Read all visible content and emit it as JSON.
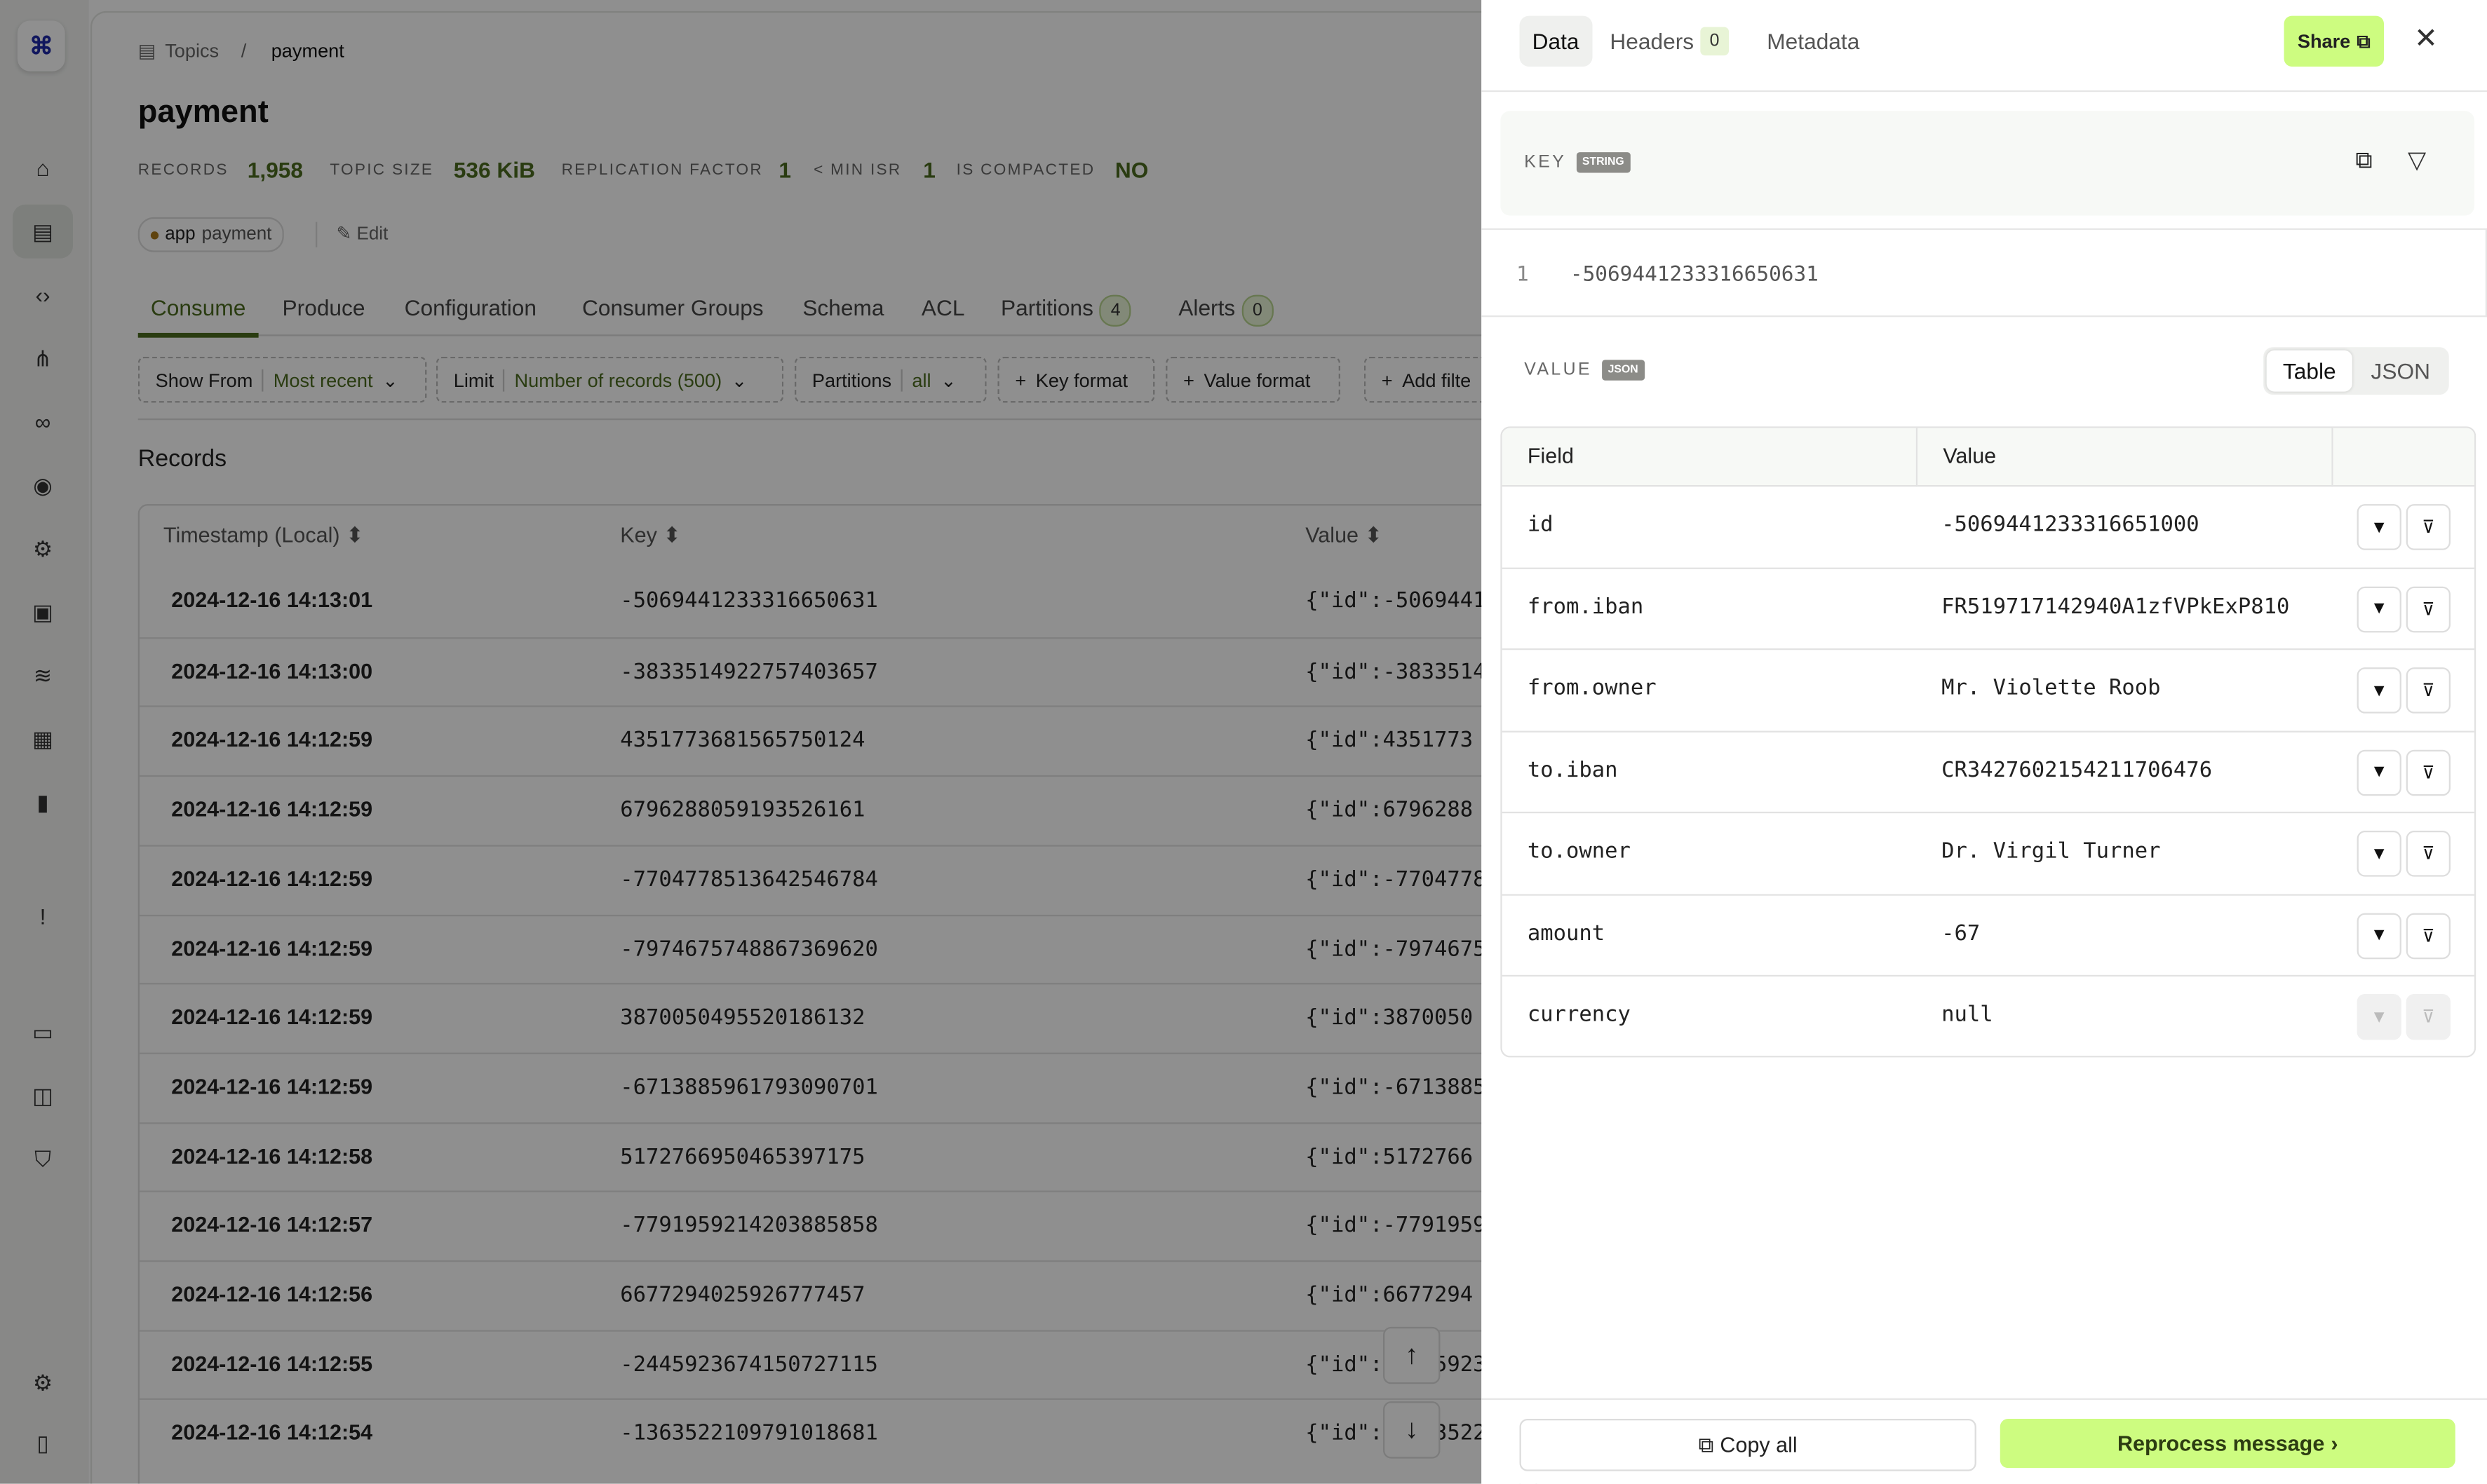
{
  "sidebar": {
    "logo": "kafka-logo",
    "items": [
      {
        "icon": "home-icon"
      },
      {
        "icon": "topics-icon",
        "active": true
      },
      {
        "icon": "code-icon"
      },
      {
        "icon": "hierarchy-icon"
      },
      {
        "icon": "link-icon"
      },
      {
        "icon": "brain-icon"
      },
      {
        "icon": "chip-icon"
      },
      {
        "icon": "file-lock-icon"
      },
      {
        "icon": "database-icon"
      },
      {
        "icon": "table-icon"
      },
      {
        "icon": "bar-chart-icon"
      },
      {
        "icon": "alert-icon"
      },
      {
        "icon": "window-icon"
      },
      {
        "icon": "layout-icon"
      },
      {
        "icon": "shield-icon"
      },
      {
        "icon": "settings-icon"
      },
      {
        "icon": "sidebar-toggle-icon"
      }
    ]
  },
  "breadcrumb": {
    "parent": "Topics",
    "separator": "/",
    "current": "payment"
  },
  "topic": {
    "title": "payment",
    "stats": [
      {
        "label": "RECORDS",
        "value": "1,958"
      },
      {
        "label": "TOPIC SIZE",
        "value": "536 KiB"
      },
      {
        "label": "REPLICATION FACTOR",
        "value": "1"
      },
      {
        "label": "< MIN ISR",
        "value": "1"
      },
      {
        "label": "IS COMPACTED",
        "value": "NO"
      }
    ],
    "tag": {
      "key": "app",
      "value": "payment"
    },
    "edit_label": "Edit"
  },
  "tabs": [
    {
      "label": "Consume",
      "active": true
    },
    {
      "label": "Produce"
    },
    {
      "label": "Configuration"
    },
    {
      "label": "Consumer Groups"
    },
    {
      "label": "Schema"
    },
    {
      "label": "ACL"
    },
    {
      "label": "Partitions",
      "badge": "4"
    },
    {
      "label": "Alerts",
      "badge": "0"
    }
  ],
  "filters": [
    {
      "label": "Show From",
      "value": "Most recent"
    },
    {
      "label": "Limit",
      "value": "Number of records (500)"
    },
    {
      "label": "Partitions",
      "value": "all"
    },
    {
      "label": "Key format"
    },
    {
      "label": "Value format"
    },
    {
      "label": "Add filte"
    }
  ],
  "records": {
    "heading": "Records",
    "columns": [
      "Timestamp (Local)",
      "Key",
      "Value"
    ],
    "rows": [
      {
        "ts": "2024-12-16 14:13:01",
        "key": "-5069441233316650631",
        "value": "{\"id\":-5069441"
      },
      {
        "ts": "2024-12-16 14:13:00",
        "key": "-3833514922757403657",
        "value": "{\"id\":-3833514"
      },
      {
        "ts": "2024-12-16 14:12:59",
        "key": "4351773681565750124",
        "value": "{\"id\":4351773"
      },
      {
        "ts": "2024-12-16 14:12:59",
        "key": "6796288059193526161",
        "value": "{\"id\":6796288"
      },
      {
        "ts": "2024-12-16 14:12:59",
        "key": "-7704778513642546784",
        "value": "{\"id\":-7704778"
      },
      {
        "ts": "2024-12-16 14:12:59",
        "key": "-7974675748867369620",
        "value": "{\"id\":-7974675"
      },
      {
        "ts": "2024-12-16 14:12:59",
        "key": "3870050495520186132",
        "value": "{\"id\":3870050"
      },
      {
        "ts": "2024-12-16 14:12:59",
        "key": "-6713885961793090701",
        "value": "{\"id\":-6713885"
      },
      {
        "ts": "2024-12-16 14:12:58",
        "key": "5172766950465397175",
        "value": "{\"id\":5172766"
      },
      {
        "ts": "2024-12-16 14:12:57",
        "key": "-7791959214203885858",
        "value": "{\"id\":-7791959"
      },
      {
        "ts": "2024-12-16 14:12:56",
        "key": "6677294025926777457",
        "value": "{\"id\":6677294"
      },
      {
        "ts": "2024-12-16 14:12:55",
        "key": "-2445923674150727115",
        "value": "{\"id\":-2445923"
      },
      {
        "ts": "2024-12-16 14:12:54",
        "key": "-1363522109791018681",
        "value": "{\"id\":-1363522"
      }
    ]
  },
  "panel": {
    "tabs": [
      {
        "label": "Data",
        "active": true
      },
      {
        "label": "Headers",
        "badge": "0"
      },
      {
        "label": "Metadata"
      }
    ],
    "share_label": "Share",
    "close_icon": "close-icon",
    "key": {
      "label": "KEY",
      "type": "STRING",
      "line": "1",
      "value": "-5069441233316650631"
    },
    "value": {
      "label": "VALUE",
      "type": "JSON",
      "view_options": [
        "Table",
        "JSON"
      ],
      "selected_view": "Table",
      "columns": [
        "Field",
        "Value"
      ],
      "rows": [
        {
          "field": "id",
          "value": "-5069441233316651000"
        },
        {
          "field": "from.iban",
          "value": "FR519717142940A1zfVPkExP810"
        },
        {
          "field": "from.owner",
          "value": "Mr. Violette Roob"
        },
        {
          "field": "to.iban",
          "value": "CR3427602154211706476"
        },
        {
          "field": "to.owner",
          "value": "Dr. Virgil Turner"
        },
        {
          "field": "amount",
          "value": "-67"
        },
        {
          "field": "currency",
          "value": "null",
          "disabled": true
        }
      ]
    },
    "copy_all_label": "Copy all",
    "reprocess_label": "Reprocess message"
  },
  "colors": {
    "accent": "#4b6b1f",
    "share": "#cdfc80"
  }
}
